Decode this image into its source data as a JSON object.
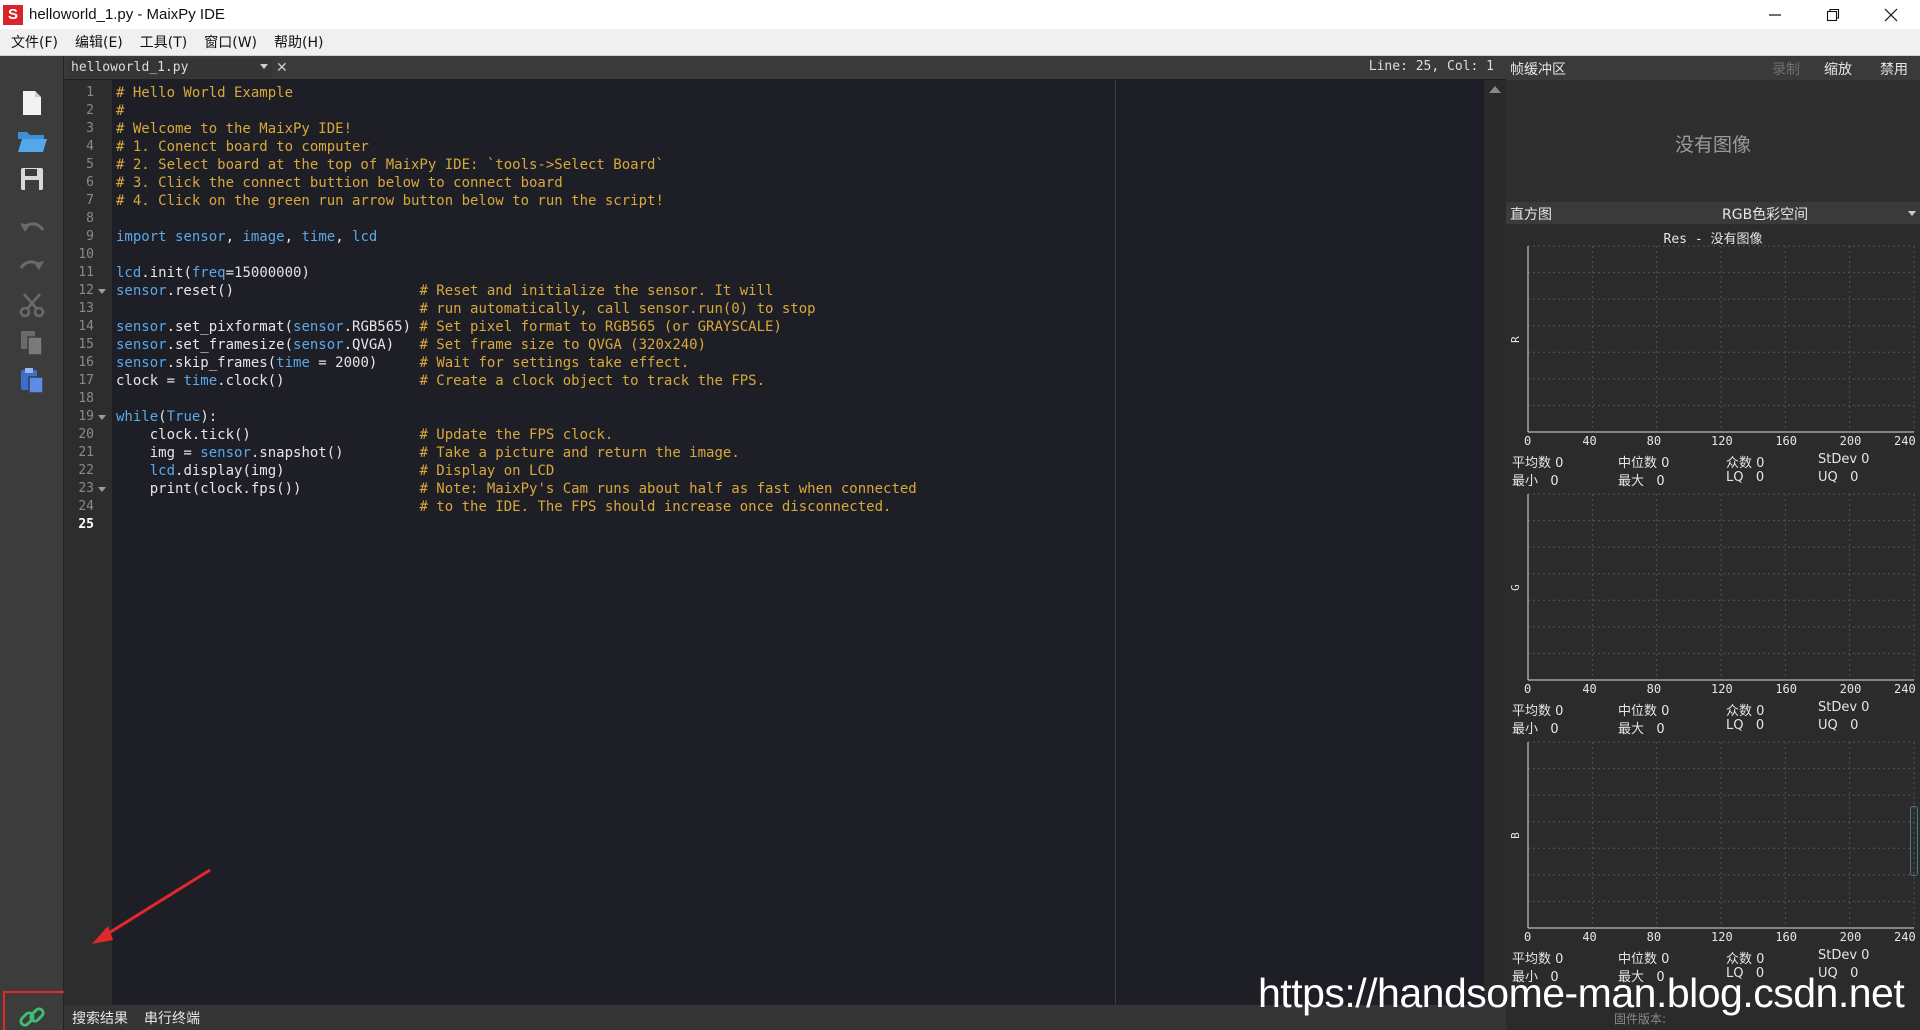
{
  "window": {
    "title": "helloworld_1.py - MaixPy IDE",
    "app_icon_letter": "S"
  },
  "menu": [
    "文件(F)",
    "编辑(E)",
    "工具(T)",
    "窗口(W)",
    "帮助(H)"
  ],
  "editor": {
    "tab_name": "helloworld_1.py",
    "cursor_status": "Line: 25, Col: 1",
    "current_line": 25
  },
  "code_lines": [
    "# Hello World Example",
    "#",
    "# Welcome to the MaixPy IDE!",
    "# 1. Conenct board to computer",
    "# 2. Select board at the top of MaixPy IDE: `tools->Select Board`",
    "# 3. Click the connect buttion below to connect board",
    "# 4. Click on the green run arrow button below to run the script!",
    "",
    "import sensor, image, time, lcd",
    "",
    "lcd.init(freq=15000000)",
    "sensor.reset()                      # Reset and initialize the sensor. It will",
    "                                    # run automatically, call sensor.run(0) to stop",
    "sensor.set_pixformat(sensor.RGB565) # Set pixel format to RGB565 (or GRAYSCALE)",
    "sensor.set_framesize(sensor.QVGA)   # Set frame size to QVGA (320x240)",
    "sensor.skip_frames(time = 2000)     # Wait for settings take effect.",
    "clock = time.clock()                # Create a clock object to track the FPS.",
    "",
    "while(True):",
    "    clock.tick()                    # Update the FPS clock.",
    "    img = sensor.snapshot()         # Take a picture and return the image.",
    "    lcd.display(img)                # Display on LCD",
    "    print(clock.fps())              # Note: MaixPy's Cam runs about half as fast when connected",
    "                                    # to the IDE. The FPS should increase once disconnected.",
    ""
  ],
  "bottom_tabs": [
    "搜索结果",
    "串行终端"
  ],
  "frame_buffer": {
    "title": "帧缓冲区",
    "record_label": "录制",
    "zoom_label": "缩放",
    "disable_label": "禁用",
    "no_image": "没有图像"
  },
  "histogram": {
    "title": "直方图",
    "color_space": "RGB色彩空间",
    "res_text": "Res - 没有图像",
    "x_ticks": [
      "0",
      "40",
      "80",
      "120",
      "160",
      "200",
      "240"
    ],
    "channels": [
      {
        "label": "R",
        "mean": "0",
        "median": "0",
        "mode": "0",
        "stdev": "0",
        "min": "0",
        "max": "0",
        "lq": "0",
        "uq": "0"
      },
      {
        "label": "G",
        "mean": "0",
        "median": "0",
        "mode": "0",
        "stdev": "0",
        "min": "0",
        "max": "0",
        "lq": "0",
        "uq": "0"
      },
      {
        "label": "B",
        "mean": "0",
        "median": "0",
        "mode": "0",
        "stdev": "0",
        "min": "0",
        "max": "0",
        "lq": "0",
        "uq": "0"
      }
    ],
    "stat_labels": {
      "mean": "平均数",
      "median": "中位数",
      "mode": "众数",
      "stdev": "StDev",
      "min": "最小",
      "max": "最大",
      "lq": "LQ",
      "uq": "UQ"
    }
  },
  "firmware_label": "固件版本:",
  "watermark": "https://handsome-man.blog.csdn.net",
  "colors": {
    "accent_red": "#e0292b",
    "comment": "#d8a93a",
    "keyword": "#5aa9e6",
    "connect_icon": "#3fbf6f"
  }
}
